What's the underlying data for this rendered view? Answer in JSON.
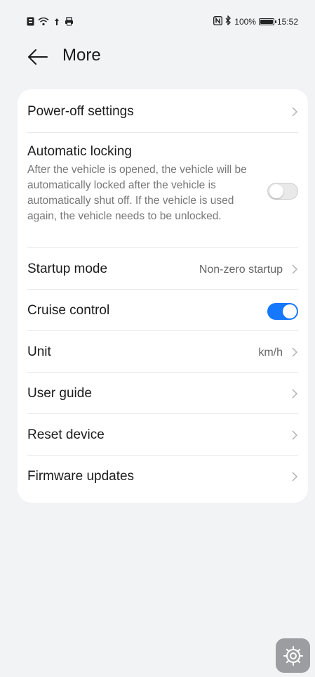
{
  "status_bar": {
    "battery_percent": "100%",
    "battery_level": 1.0,
    "time": "15:52",
    "left_icons": [
      "notification-icon",
      "wifi-icon",
      "pin-icon",
      "printer-icon"
    ],
    "right_icons": [
      "nfc-icon",
      "bluetooth-icon"
    ]
  },
  "header": {
    "title": "More",
    "back_icon": "back-arrow-icon"
  },
  "settings": {
    "power_off": {
      "label": "Power-off settings"
    },
    "auto_lock": {
      "label": "Automatic locking",
      "description": "After the vehicle is opened, the vehicle will be automatically locked after the vehicle is automatically shut off. If the vehicle is used again, the vehicle needs to be unlocked.",
      "enabled": false
    },
    "startup_mode": {
      "label": "Startup mode",
      "value": "Non-zero startup"
    },
    "cruise_control": {
      "label": "Cruise control",
      "enabled": true
    },
    "unit": {
      "label": "Unit",
      "value": "km/h"
    },
    "user_guide": {
      "label": "User guide"
    },
    "reset_device": {
      "label": "Reset device"
    },
    "firmware_updates": {
      "label": "Firmware updates"
    }
  },
  "colors": {
    "accent": "#1677ff",
    "background": "#f1f3f5",
    "card": "#ffffff",
    "floating_button": "#9b9da0"
  },
  "floating_button": {
    "icon": "gear-icon"
  }
}
